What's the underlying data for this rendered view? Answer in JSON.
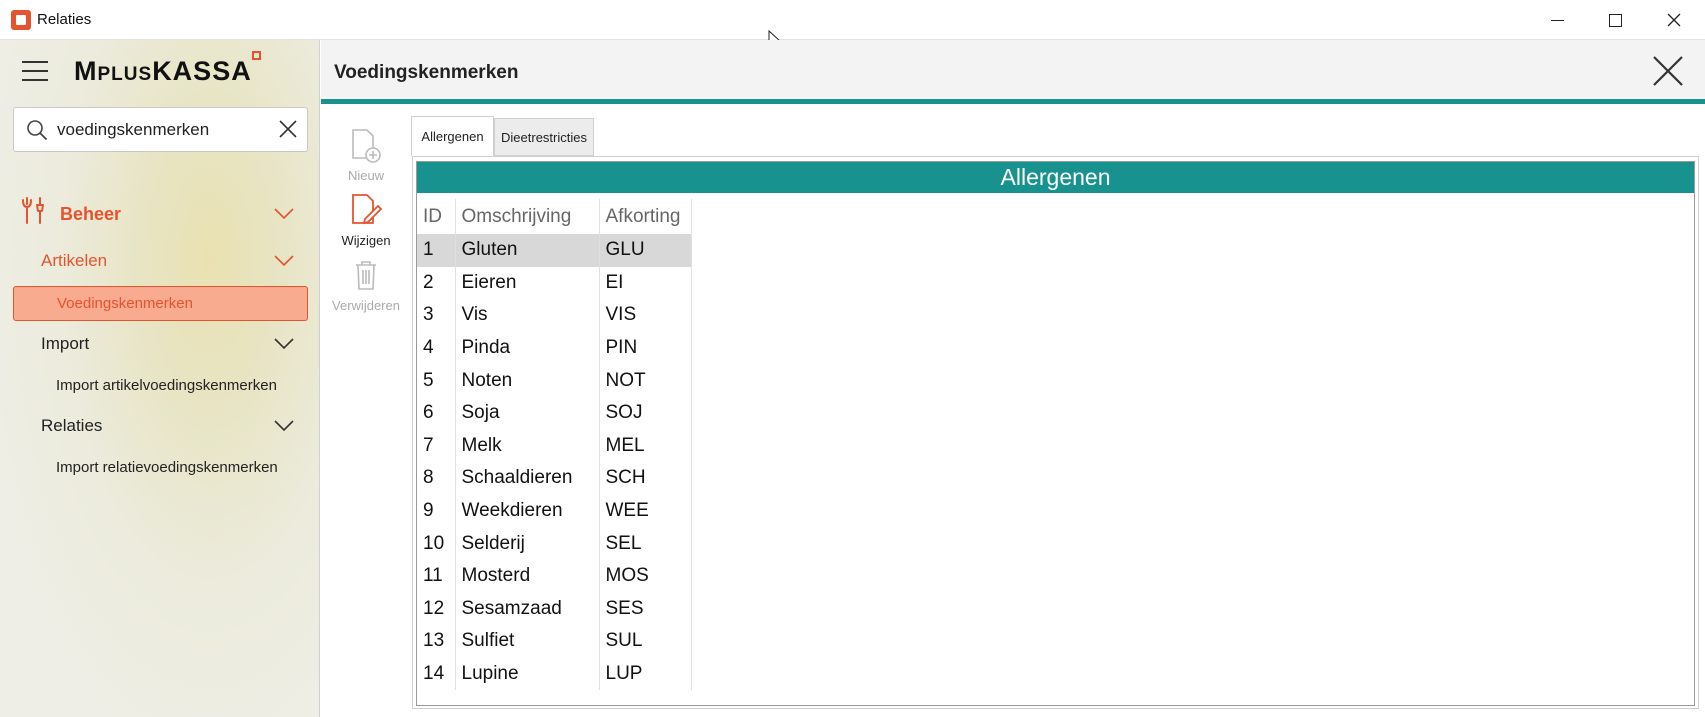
{
  "window": {
    "title": "Relaties",
    "minimize_icon": "minimize-icon",
    "maximize_icon": "maximize-icon",
    "close_icon": "close-icon"
  },
  "sidebar": {
    "logo_text_1": "M",
    "logo_text_2": "PLUS",
    "logo_text_3": "KASSA",
    "search": {
      "value": "voedingskenmerken",
      "placeholder": ""
    },
    "items": [
      {
        "label": "Beheer",
        "icon": "wrench-screwdriver-icon",
        "expanded": true
      },
      {
        "label": "Artikelen",
        "expanded": true
      },
      {
        "label": "Voedingskenmerken",
        "active": true
      },
      {
        "label": "Import",
        "expanded": true
      },
      {
        "label": "Import artikelvoedingskenmerken"
      },
      {
        "label": "Relaties",
        "expanded": true
      },
      {
        "label": "Import relatievoedingskenmerken"
      }
    ]
  },
  "header": {
    "title": "Voedingskenmerken"
  },
  "toolbar": {
    "new_label": "Nieuw",
    "edit_label": "Wijzigen",
    "delete_label": "Verwijderen"
  },
  "tabs": [
    {
      "label": "Allergenen",
      "active": true
    },
    {
      "label": "Dieetrestricties",
      "active": false
    }
  ],
  "grid": {
    "title": "Allergenen",
    "columns": [
      "ID",
      "Omschrijving",
      "Afkorting"
    ],
    "rows": [
      [
        "1",
        "Gluten",
        "GLU"
      ],
      [
        "2",
        "Eieren",
        "EI"
      ],
      [
        "3",
        "Vis",
        "VIS"
      ],
      [
        "4",
        "Pinda",
        "PIN"
      ],
      [
        "5",
        "Noten",
        "NOT"
      ],
      [
        "6",
        "Soja",
        "SOJ"
      ],
      [
        "7",
        "Melk",
        "MEL"
      ],
      [
        "8",
        "Schaaldieren",
        "SCH"
      ],
      [
        "9",
        "Weekdieren",
        "WEE"
      ],
      [
        "10",
        "Selderij",
        "SEL"
      ],
      [
        "11",
        "Mosterd",
        "MOS"
      ],
      [
        "12",
        "Sesamzaad",
        "SES"
      ],
      [
        "13",
        "Sulfiet",
        "SUL"
      ],
      [
        "14",
        "Lupine",
        "LUP"
      ]
    ],
    "selected_row": 0
  },
  "colors": {
    "accent": "#e5532f",
    "teal": "#17928f"
  }
}
